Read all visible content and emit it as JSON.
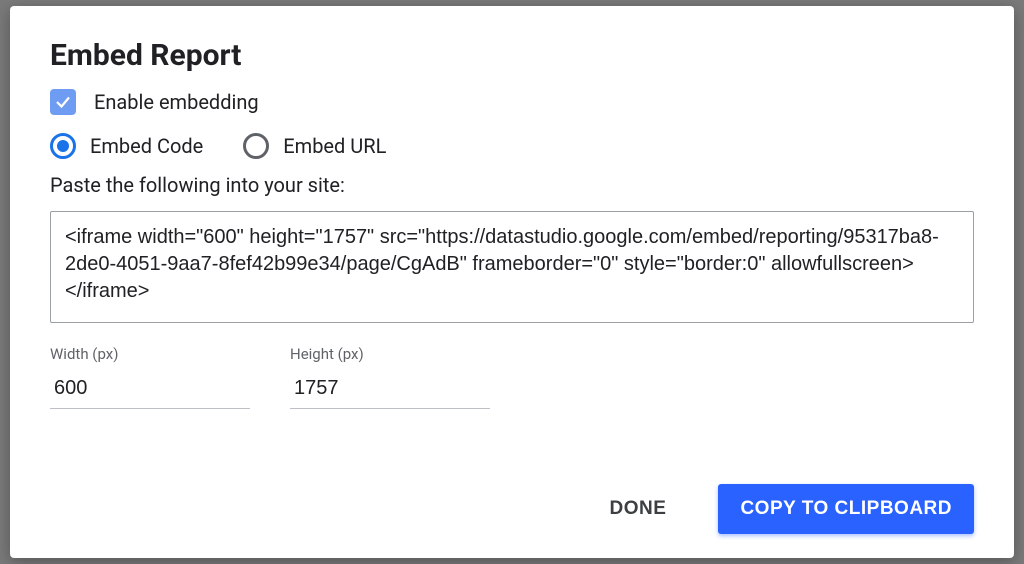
{
  "dialog": {
    "title": "Embed Report",
    "enable_embedding_label": "Enable embedding",
    "enable_embedding_checked": true,
    "radio_embed_code_label": "Embed Code",
    "radio_embed_url_label": "Embed URL",
    "radio_selected": "code",
    "instruction": "Paste the following into your site:",
    "code": "<iframe width=\"600\" height=\"1757\" src=\"https://datastudio.google.com/embed/reporting/95317ba8-2de0-4051-9aa7-8fef42b99e34/page/CgAdB\" frameborder=\"0\" style=\"border:0\" allowfullscreen></iframe>",
    "width_label": "Width (px)",
    "width_value": "600",
    "height_label": "Height (px)",
    "height_value": "1757",
    "done_label": "DONE",
    "copy_label": "COPY TO CLIPBOARD"
  }
}
